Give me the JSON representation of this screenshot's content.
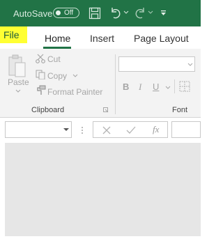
{
  "titlebar": {
    "autosave_label": "AutoSave",
    "autosave_state": "Off",
    "icons": [
      "save-icon",
      "undo-icon",
      "redo-icon",
      "customize-quick-access-icon"
    ]
  },
  "tabs": {
    "file": "File",
    "home": "Home",
    "insert": "Insert",
    "page_layout": "Page Layout"
  },
  "clipboard": {
    "paste": "Paste",
    "cut": "Cut",
    "copy": "Copy",
    "format_painter": "Format Painter",
    "group_label": "Clipboard"
  },
  "font": {
    "bold": "B",
    "italic": "I",
    "underline": "U",
    "group_label": "Font"
  },
  "formula_bar": {
    "fx": "fx"
  },
  "colors": {
    "title_bar": "#217346",
    "file_highlight": "#ffff33",
    "ribbon": "#f3f3f3"
  }
}
